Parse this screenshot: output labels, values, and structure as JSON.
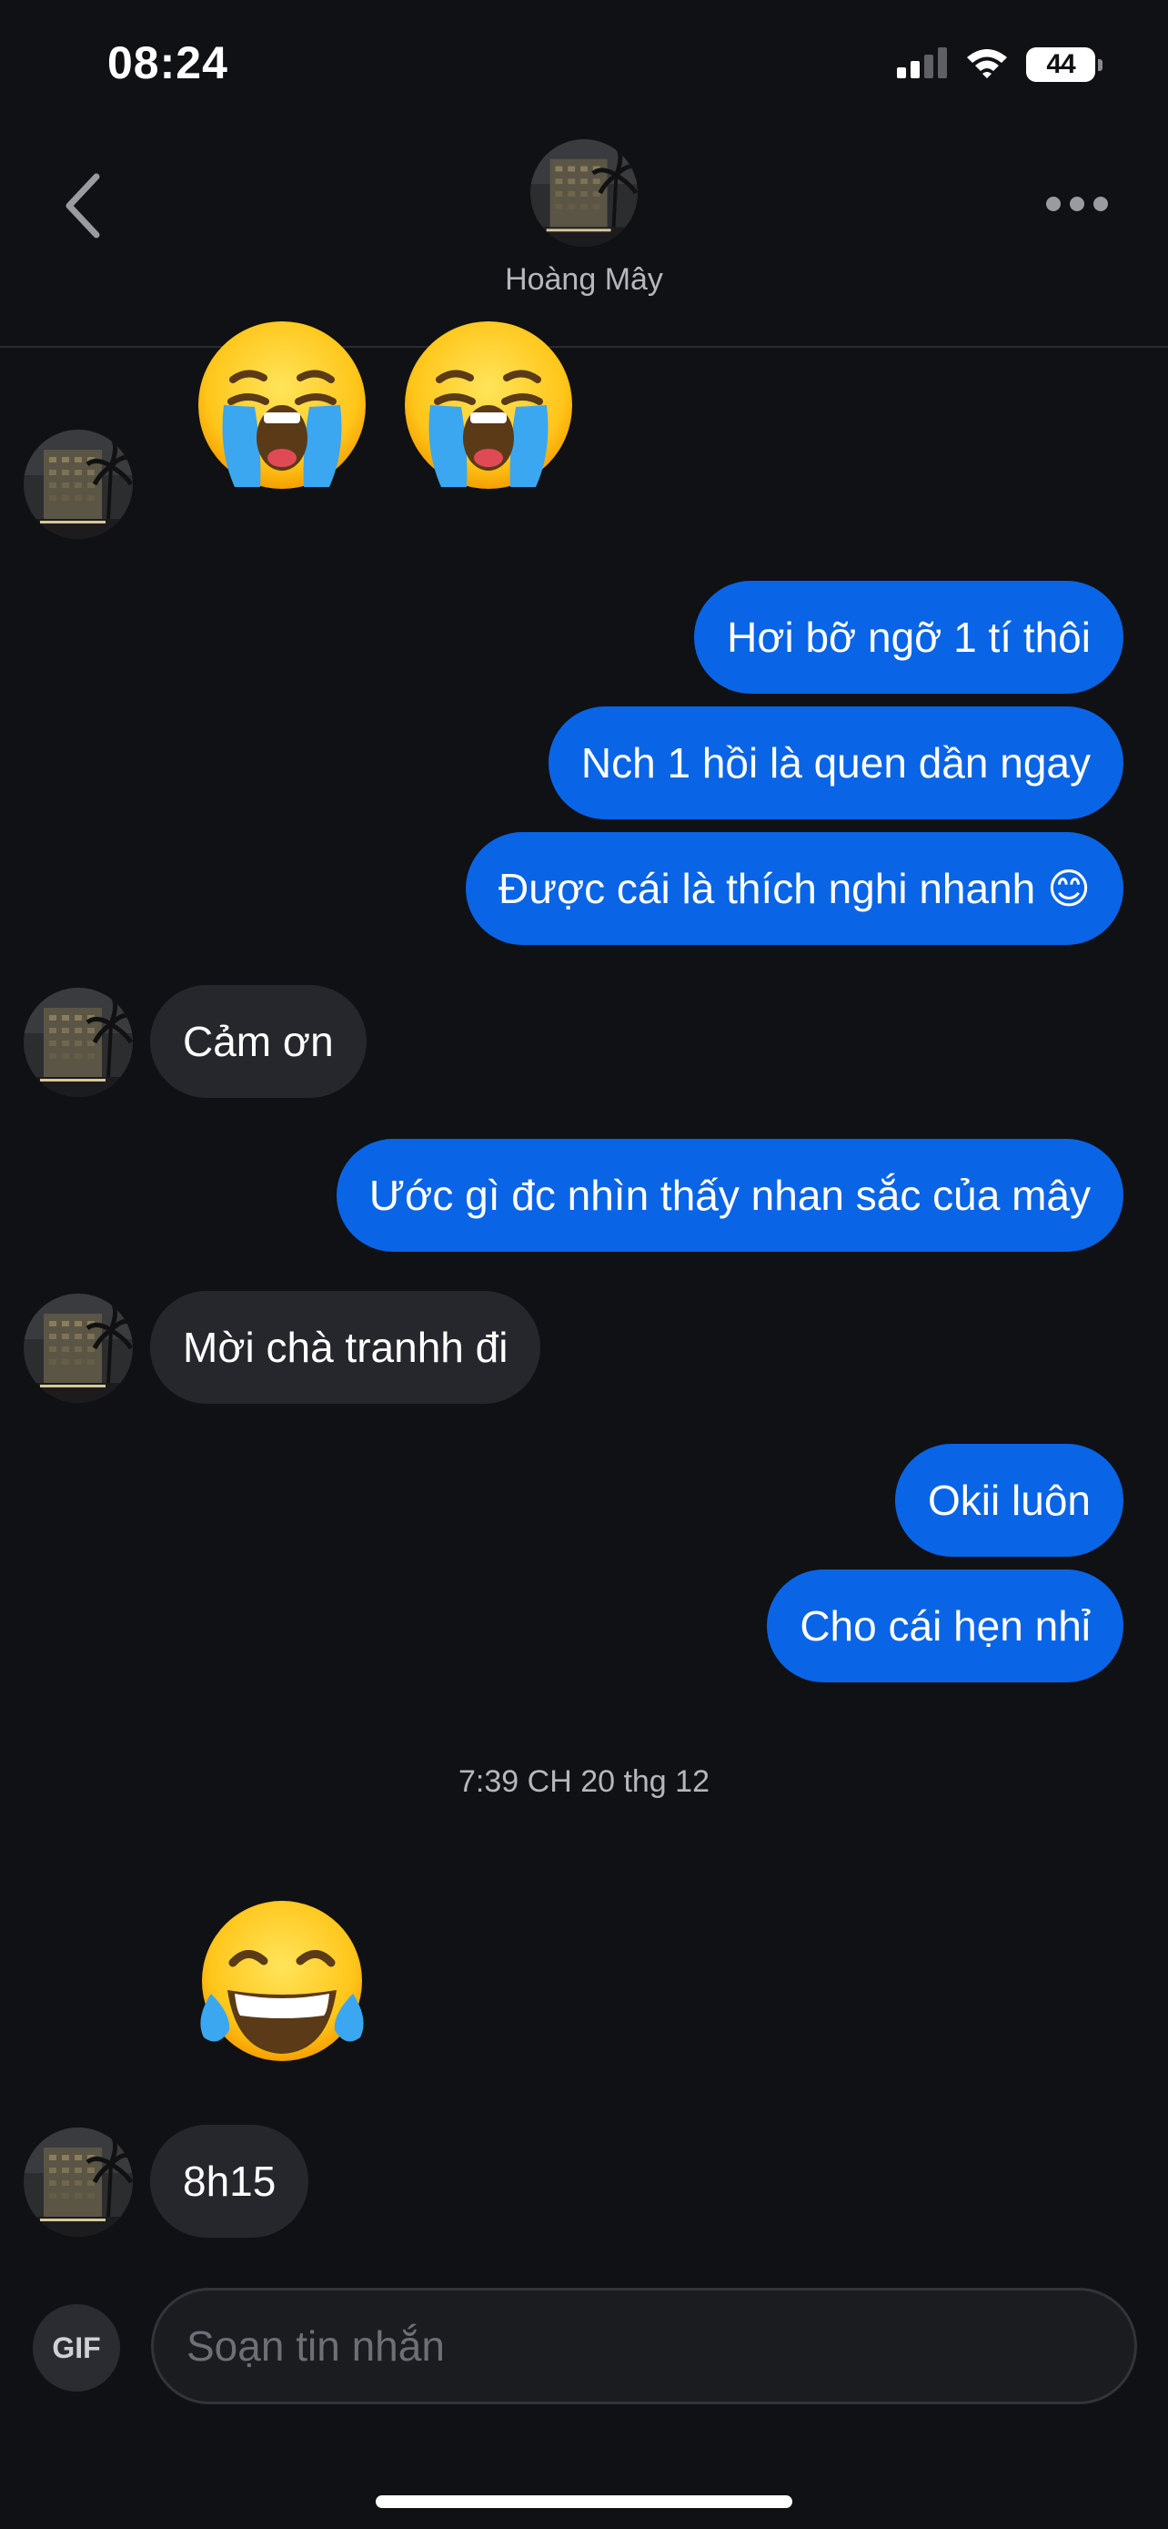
{
  "status_bar": {
    "time": "08:24",
    "battery_level": "44",
    "icons": [
      "cellular-signal-icon",
      "wifi-icon",
      "battery-icon"
    ]
  },
  "header": {
    "contact_name": "Hoàng Mây",
    "icons": [
      "chevron-left-icon",
      "more-dots-icon"
    ]
  },
  "messages": [
    {
      "type": "emoji",
      "from": "them",
      "emoji": "loudly-crying-face",
      "count": 2
    },
    {
      "type": "text",
      "from": "me",
      "text": "Hơi bỡ ngỡ 1 tí thôi"
    },
    {
      "type": "text",
      "from": "me",
      "text": "Nch 1 hồi là quen dần ngay"
    },
    {
      "type": "text",
      "from": "me",
      "text": "Được cái là thích nghi nhanh 😊"
    },
    {
      "type": "text",
      "from": "them",
      "text": "Cảm ơn"
    },
    {
      "type": "text",
      "from": "me",
      "text": "Ước gì đc nhìn thấy nhan sắc của mây"
    },
    {
      "type": "text",
      "from": "them",
      "text": "Mời chà tranhh đi"
    },
    {
      "type": "text",
      "from": "me",
      "text": "Okii luôn"
    },
    {
      "type": "text",
      "from": "me",
      "text": "Cho cái hẹn nhỉ"
    },
    {
      "type": "timestamp",
      "text": "7:39 CH 20 thg 12"
    },
    {
      "type": "emoji",
      "from": "them",
      "emoji": "face-with-tears-of-joy",
      "count": 1
    },
    {
      "type": "text",
      "from": "them",
      "text": "8h15"
    }
  ],
  "composer": {
    "gif_label": "GIF",
    "placeholder": "Soạn tin nhắn",
    "value": ""
  },
  "colors": {
    "background": "#101114",
    "outgoing_bubble": "#0a64e6",
    "incoming_bubble": "#26272c",
    "secondary_text": "#b6b7bc"
  }
}
